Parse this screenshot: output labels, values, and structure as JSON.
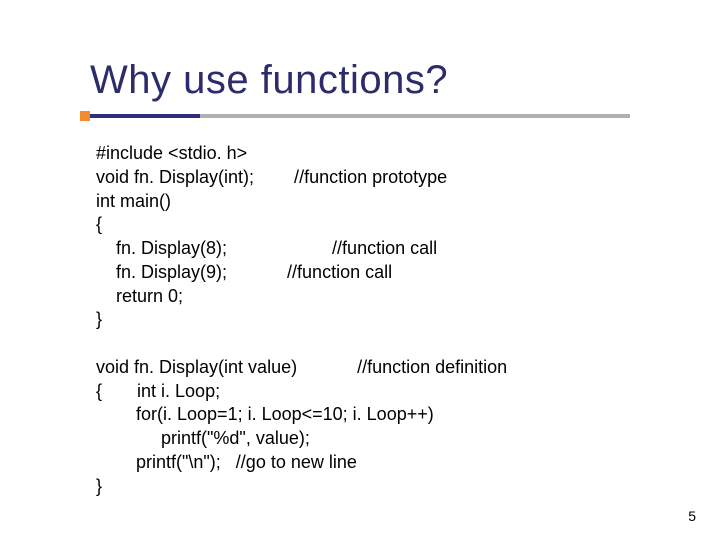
{
  "title": "Why use functions?",
  "code": {
    "l1": "#include <stdio. h>",
    "l2": "void fn. Display(int);        //function prototype",
    "l3": "int main()",
    "l4": "{",
    "l5": "    fn. Display(8);                     //function call",
    "l6": "    fn. Display(9);            //function call",
    "l7": "    return 0;",
    "l8": "}",
    "l9": "",
    "l10": "void fn. Display(int value)            //function definition",
    "l11": "{       int i. Loop;",
    "l12": "        for(i. Loop=1; i. Loop<=10; i. Loop++)",
    "l13": "             printf(\"%d\", value);",
    "l14": "        printf(\"\\n\");   //go to new line",
    "l15": "}"
  },
  "page_number": "5"
}
